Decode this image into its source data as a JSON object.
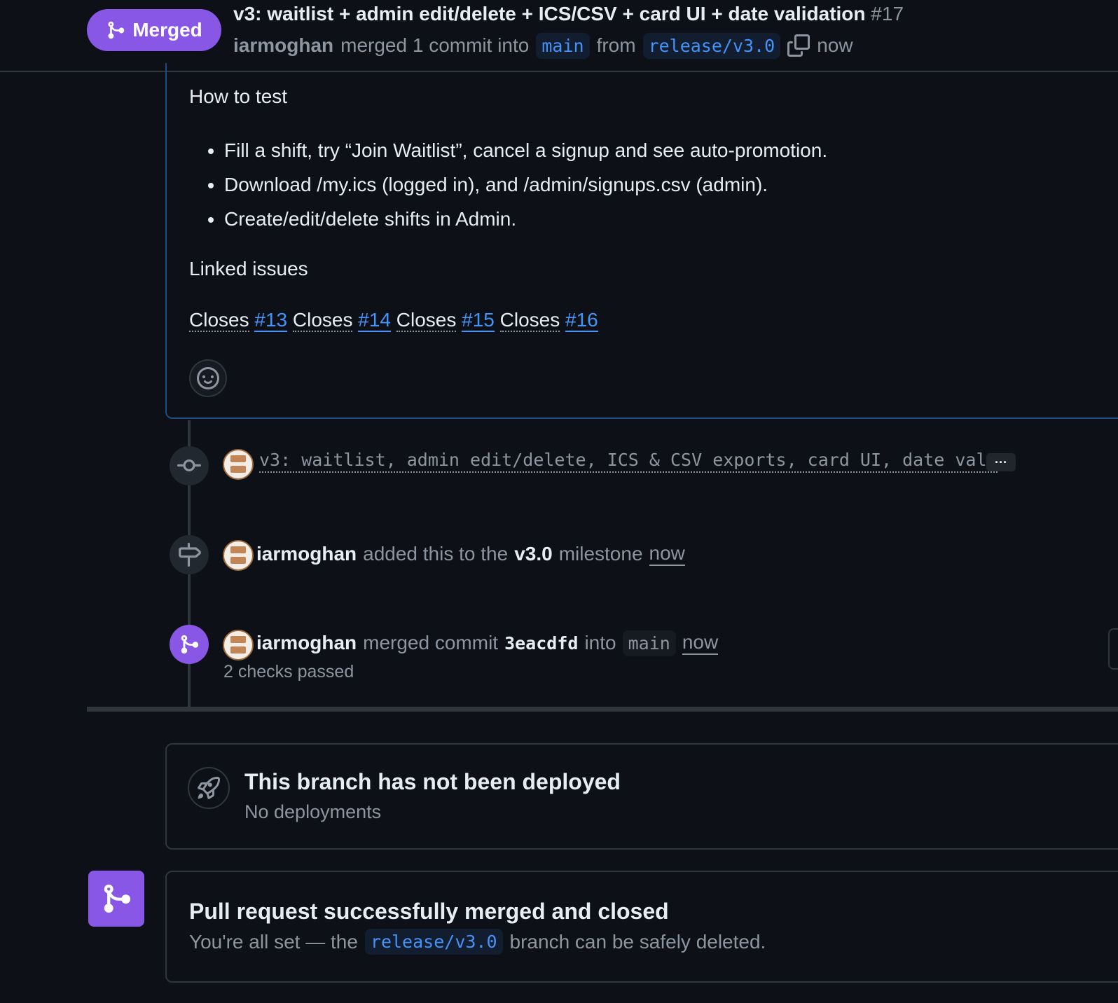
{
  "header": {
    "state_label": "Merged",
    "title": "v3: waitlist + admin edit/delete + ICS/CSV + card UI + date validation",
    "number": "#17",
    "author": "iarmoghan",
    "merged_text": "merged 1 commit into",
    "base_branch": "main",
    "from_text": "from",
    "head_branch": "release/v3.0",
    "time": "now"
  },
  "comment": {
    "how_to_test_heading": "How to test",
    "bullets": [
      "Fill a shift, try “Join Waitlist”, cancel a signup and see auto-promotion.",
      "Download /my.ics (logged in), and /admin/signups.csv (admin).",
      "Create/edit/delete shifts in Admin."
    ],
    "linked_issues_heading": "Linked issues",
    "closes": [
      {
        "word": "Closes",
        "issue": "#13"
      },
      {
        "word": "Closes",
        "issue": "#14"
      },
      {
        "word": "Closes",
        "issue": "#15"
      },
      {
        "word": "Closes",
        "issue": "#16"
      }
    ]
  },
  "timeline": {
    "commit_message": "v3: waitlist, admin edit/delete, ICS & CSV exports, card UI, date val…",
    "commit_more": "···",
    "milestone_event": {
      "actor": "iarmoghan",
      "text_before": "added this to the",
      "milestone": "v3.0",
      "text_after": "milestone",
      "time": "now"
    },
    "merge_event": {
      "actor": "iarmoghan",
      "text_before": "merged commit",
      "sha": "3eacdfd",
      "text_into": "into",
      "branch": "main",
      "time": "now",
      "checks": "2 checks passed"
    }
  },
  "deploy": {
    "title": "This branch has not been deployed",
    "subtitle": "No deployments"
  },
  "merged_panel": {
    "title": "Pull request successfully merged and closed",
    "text_before": "You're all set — the",
    "branch": "release/v3.0",
    "text_after": "branch can be safely deleted."
  },
  "colors": {
    "background": "#0d1117",
    "merged_purple": "#8957e5",
    "link_blue": "#4493f8",
    "muted_text": "#8d96a0",
    "border": "#30363d"
  }
}
